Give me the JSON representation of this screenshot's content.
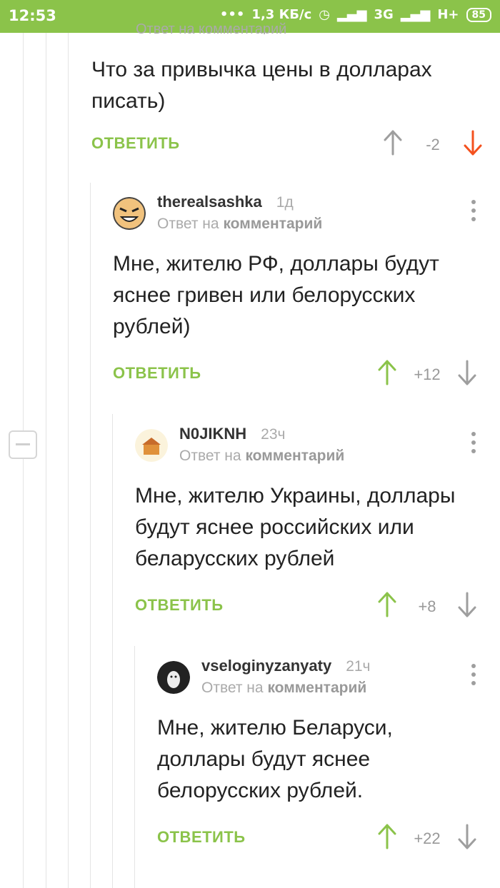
{
  "status": {
    "time": "12:53",
    "speed": "1,3 КБ/с",
    "network1": "3G",
    "network2": "H+",
    "battery": "85"
  },
  "top_comment": {
    "partial_header": "Ответ на комментарий",
    "text": "Что за привычка цены в долларах писать)",
    "reply_label": "ОТВЕТИТЬ",
    "score": "-2"
  },
  "comments": [
    {
      "author": "therealsashka",
      "time": "1д",
      "reply_prefix": "Ответ на",
      "reply_target": "комментарий",
      "text": "Мне, жителю РФ, доллары будут яснее гривен или белорусских рублей)",
      "reply_label": "ОТВЕТИТЬ",
      "score": "+12"
    },
    {
      "author": "N0JIKNH",
      "time": "23ч",
      "reply_prefix": "Ответ на",
      "reply_target": "комментарий",
      "text": "Мне, жителю Украины, доллары будут яснее российских или беларусских рублей",
      "reply_label": "ОТВЕТИТЬ",
      "score": "+8"
    },
    {
      "author": "vseloginyzanyaty",
      "time": "21ч",
      "reply_prefix": "Ответ на",
      "reply_target": "комментарий",
      "text": "Мне, жителю Беларуси, доллары будут яснее белорусских рублей.",
      "reply_label": "ОТВЕТИТЬ",
      "score": "+22"
    }
  ],
  "colors": {
    "accent": "#8bc34a",
    "downvoted": "#f4511e",
    "muted": "#999999"
  }
}
